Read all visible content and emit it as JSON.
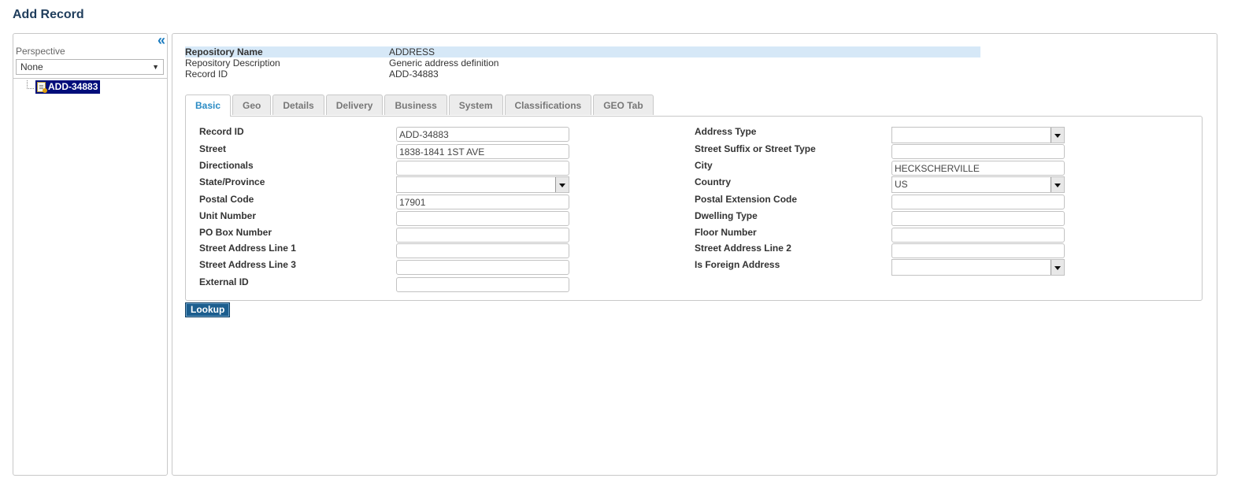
{
  "page": {
    "title": "Add Record"
  },
  "sidebar": {
    "collapse_glyph": "«",
    "perspective_label": "Perspective",
    "perspective_value": "None",
    "tree_node": "ADD-34883"
  },
  "repository": {
    "rows": [
      {
        "key": "Repository Name",
        "value": "ADDRESS"
      },
      {
        "key": "Repository Description",
        "value": "Generic address definition"
      },
      {
        "key": "Record ID",
        "value": "ADD-34883"
      }
    ]
  },
  "tabs": [
    "Basic",
    "Geo",
    "Details",
    "Delivery",
    "Business",
    "System",
    "Classifications",
    "GEO Tab"
  ],
  "form": {
    "left": [
      {
        "label": "Record ID",
        "value": "ADD-34883",
        "kind": "input"
      },
      {
        "label": "Street",
        "value": "1838-1841 1ST AVE",
        "kind": "input"
      },
      {
        "label": "Directionals",
        "value": "",
        "kind": "input"
      },
      {
        "label": "State/Province",
        "value": "",
        "kind": "select"
      },
      {
        "label": "Postal Code",
        "value": "17901",
        "kind": "input"
      },
      {
        "label": "Unit Number",
        "value": "",
        "kind": "input"
      },
      {
        "label": "PO Box Number",
        "value": "",
        "kind": "input"
      },
      {
        "label": "Street Address Line 1",
        "value": "",
        "kind": "input"
      },
      {
        "label": "Street Address Line 3",
        "value": "",
        "kind": "input"
      },
      {
        "label": "External ID",
        "value": "",
        "kind": "input"
      }
    ],
    "right": [
      {
        "label": "Address Type",
        "value": "",
        "kind": "select"
      },
      {
        "label": "Street Suffix or Street Type",
        "value": "",
        "kind": "input"
      },
      {
        "label": "City",
        "value": "HECKSCHERVILLE",
        "kind": "input"
      },
      {
        "label": "Country",
        "value": "US",
        "kind": "select"
      },
      {
        "label": "Postal Extension Code",
        "value": "",
        "kind": "input"
      },
      {
        "label": "Dwelling Type",
        "value": "",
        "kind": "input"
      },
      {
        "label": "Floor Number",
        "value": "",
        "kind": "input"
      },
      {
        "label": "Street Address Line 2",
        "value": "",
        "kind": "input"
      },
      {
        "label": "Is Foreign Address",
        "value": "",
        "kind": "select"
      }
    ]
  },
  "actions": {
    "lookup_label": "Lookup"
  }
}
